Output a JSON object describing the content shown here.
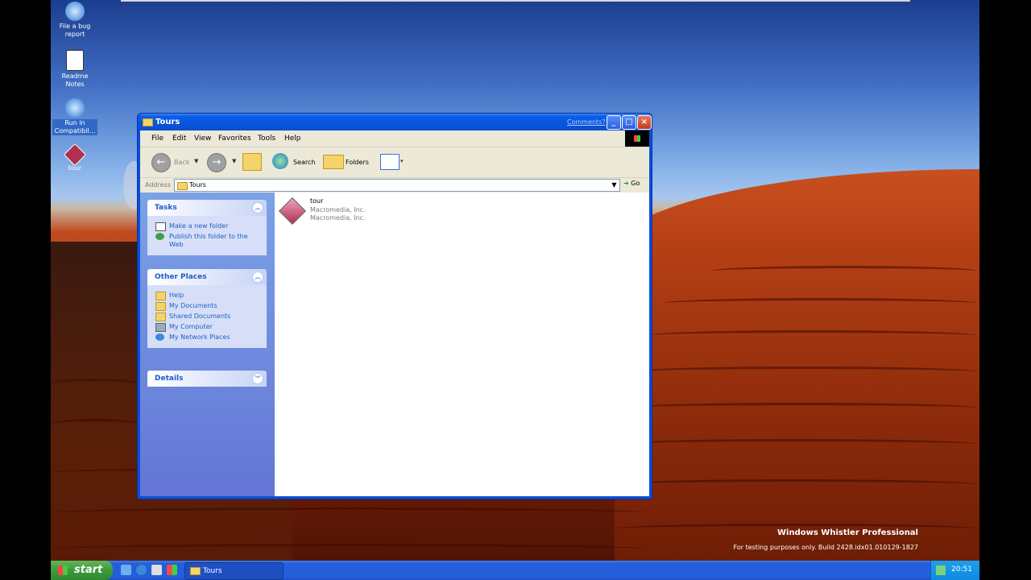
{
  "desktop": {
    "icons": [
      {
        "label": "File a bug report",
        "icon": "help-icon"
      },
      {
        "label": "Readme Notes",
        "icon": "notepad-icon"
      },
      {
        "label": "Run in Compatibil...",
        "icon": "help-icon"
      },
      {
        "label": "tour",
        "icon": "macromedia-icon"
      }
    ],
    "watermark_title": "Windows Whistler Professional",
    "watermark_sub": "For testing purposes only. Build 2428.idx01.010129-1827"
  },
  "window": {
    "title": "Tours",
    "comments_link": "Comments?",
    "menu": [
      "File",
      "Edit",
      "View",
      "Favorites",
      "Tools",
      "Help"
    ],
    "toolbar": {
      "back_label": "Back",
      "search_label": "Search",
      "folders_label": "Folders"
    },
    "address": {
      "label": "Address",
      "value": "Tours",
      "go_label": "Go"
    },
    "tasks": {
      "title": "Tasks",
      "items": [
        "Make a new folder",
        "Publish this folder to the Web"
      ]
    },
    "other_places": {
      "title": "Other Places",
      "items": [
        "Help",
        "My Documents",
        "Shared Documents",
        "My Computer",
        "My Network Places"
      ]
    },
    "details": {
      "title": "Details"
    },
    "file": {
      "name": "tour",
      "company": "Macromedia, Inc.",
      "company2": "Macromedia, Inc."
    }
  },
  "taskbar": {
    "start_label": "start",
    "task_label": "Tours",
    "clock": "20:51"
  },
  "colors": {
    "titlebar": "#0654dd",
    "taskbar": "#245edb",
    "start": "#3c9a3c",
    "link": "#215dc6"
  }
}
